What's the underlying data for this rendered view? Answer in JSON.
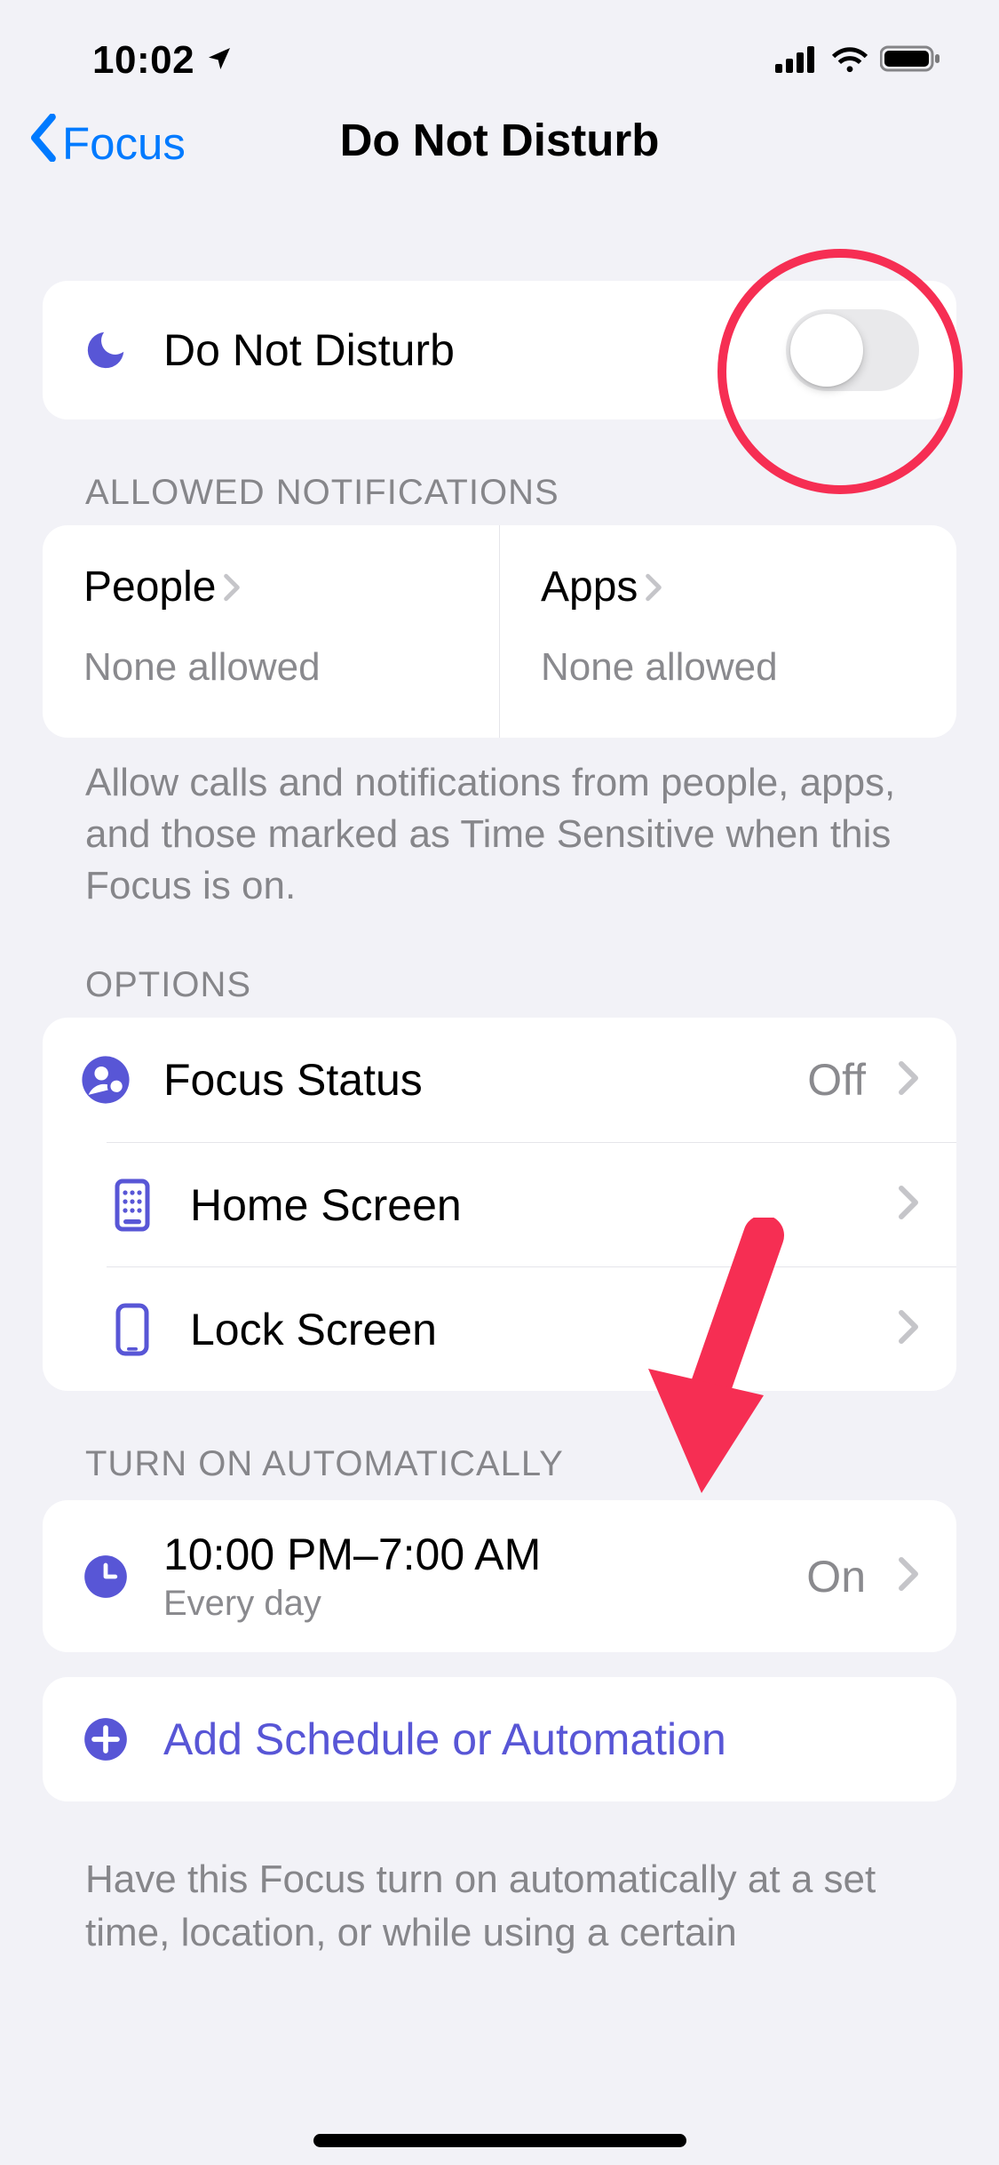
{
  "status": {
    "time": "10:02"
  },
  "nav": {
    "back_label": "Focus",
    "title": "Do Not Disturb"
  },
  "main_toggle": {
    "label": "Do Not Disturb",
    "on": false
  },
  "allowed": {
    "header": "ALLOWED NOTIFICATIONS",
    "people": {
      "title": "People",
      "sub": "None allowed"
    },
    "apps": {
      "title": "Apps",
      "sub": "None allowed"
    },
    "footer": "Allow calls and notifications from people, apps, and those marked as Time Sensitive when this Focus is on."
  },
  "options": {
    "header": "OPTIONS",
    "rows": [
      {
        "label": "Focus Status",
        "value": "Off"
      },
      {
        "label": "Home Screen",
        "value": ""
      },
      {
        "label": "Lock Screen",
        "value": ""
      }
    ]
  },
  "auto": {
    "header": "TURN ON AUTOMATICALLY",
    "schedule": {
      "title": "10:00 PM–7:00 AM",
      "sub": "Every day",
      "value": "On"
    },
    "add_label": "Add Schedule or Automation",
    "footer": "Have this Focus turn on automatically at a set time, location, or while using a certain"
  },
  "colors": {
    "accent_purple": "#5856d6",
    "link_blue": "#007aff",
    "annotation_red": "#f62e53"
  }
}
